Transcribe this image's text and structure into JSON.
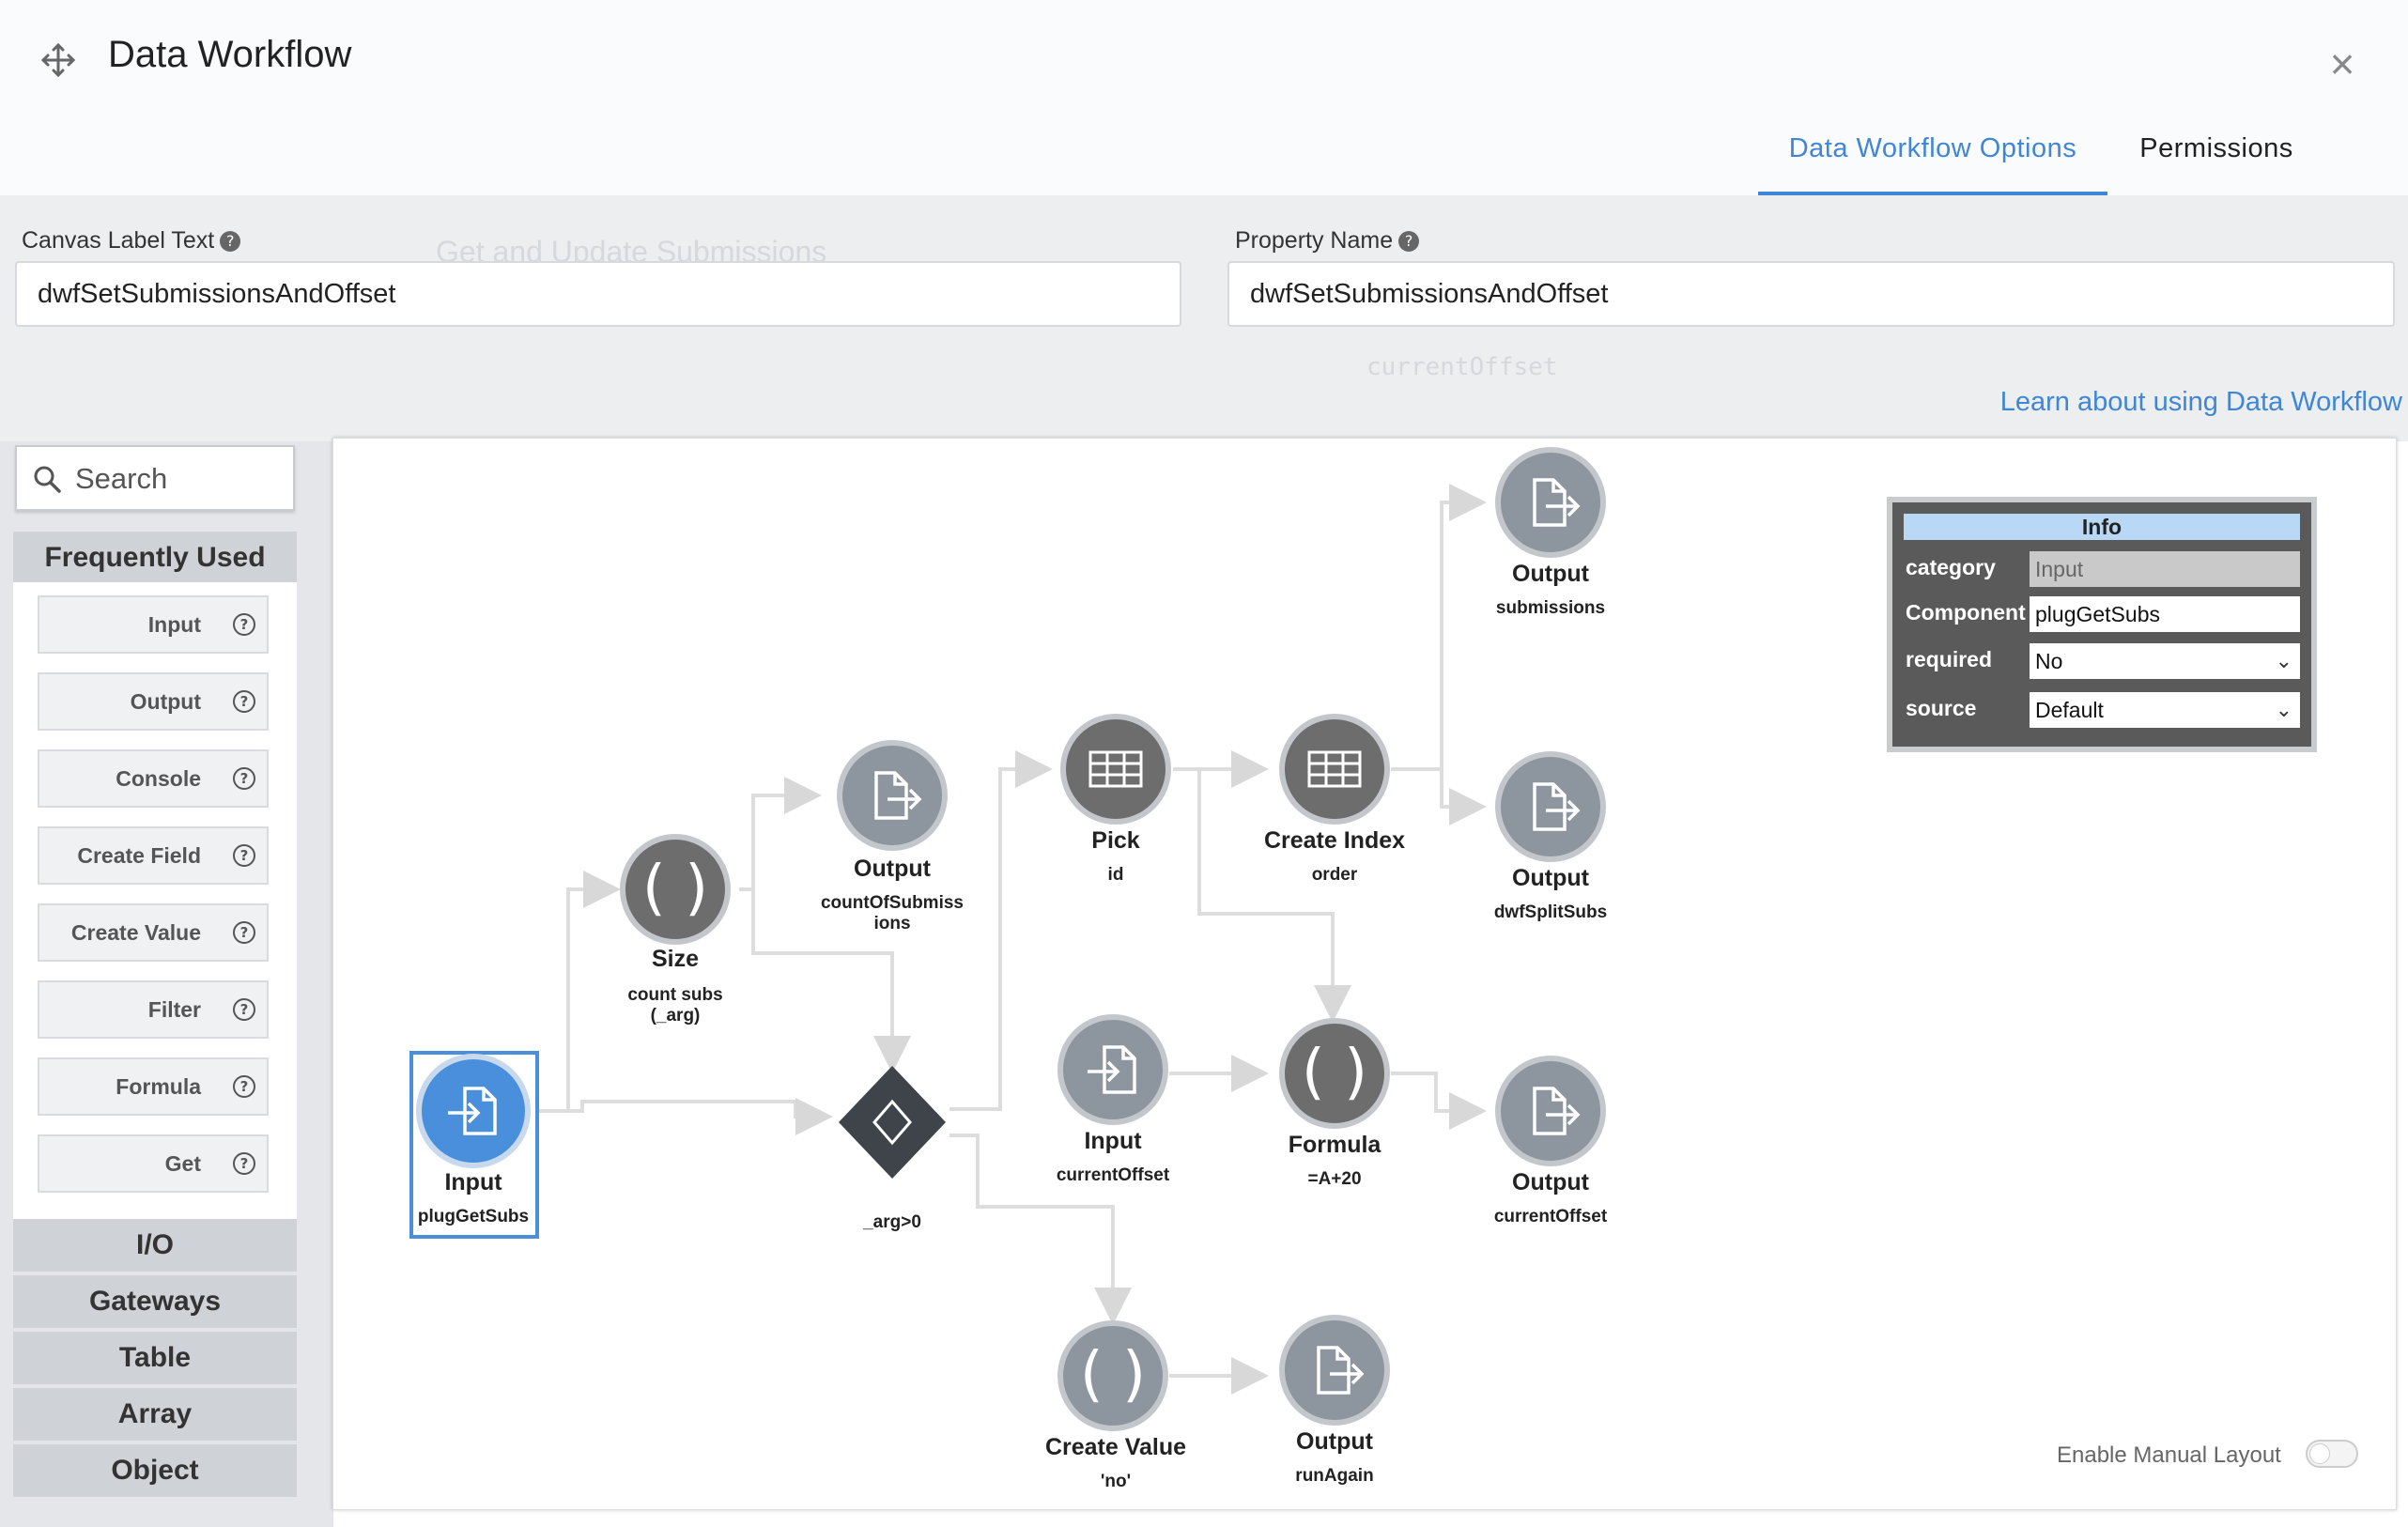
{
  "window": {
    "title": "Data Workflow"
  },
  "tabs": [
    {
      "label": "Data Workflow Options"
    },
    {
      "label": "Permissions"
    }
  ],
  "properties": {
    "canvas_label": {
      "label": "Canvas Label Text",
      "value": "dwfSetSubmissionsAndOffset"
    },
    "property_name": {
      "label": "Property Name",
      "value": "dwfSetSubmissionsAndOffset"
    },
    "learn_link": "Learn about using Data Workflow"
  },
  "background_ghost": {
    "title": "Get and Update Submissions",
    "field": "currentOffset"
  },
  "palette": {
    "search_placeholder": "Search",
    "frequently_used": "Frequently Used",
    "items": [
      "Input",
      "Output",
      "Console",
      "Create Field",
      "Create Value",
      "Filter",
      "Formula",
      "Get"
    ],
    "sections": [
      "I/O",
      "Gateways",
      "Table",
      "Array",
      "Object"
    ]
  },
  "nodes": [
    {
      "id": "n_input",
      "type": "Input",
      "label": "Input",
      "sub": "plugGetSubs"
    },
    {
      "id": "n_size",
      "type": "Size",
      "label": "Size",
      "sub": "count subs (_arg)"
    },
    {
      "id": "n_out_count",
      "type": "Output",
      "label": "Output",
      "sub": "countOfSubmissions"
    },
    {
      "id": "n_gate",
      "type": "Gateway",
      "label": "",
      "sub": "_arg>0"
    },
    {
      "id": "n_pick",
      "type": "Pick",
      "label": "Pick",
      "sub": "id"
    },
    {
      "id": "n_index",
      "type": "Create Index",
      "label": "Create Index",
      "sub": "order"
    },
    {
      "id": "n_out_subs",
      "type": "Output",
      "label": "Output",
      "sub": "submissions"
    },
    {
      "id": "n_out_split",
      "type": "Output",
      "label": "Output",
      "sub": "dwfSplitSubs"
    },
    {
      "id": "n_in_offset",
      "type": "Input",
      "label": "Input",
      "sub": "currentOffset"
    },
    {
      "id": "n_formula",
      "type": "Formula",
      "label": "Formula",
      "sub": "=A+20"
    },
    {
      "id": "n_out_offset",
      "type": "Output",
      "label": "Output",
      "sub": "currentOffset"
    },
    {
      "id": "n_create_value",
      "type": "Create Value",
      "label": "Create Value",
      "sub": "'no'"
    },
    {
      "id": "n_out_run",
      "type": "Output",
      "label": "Output",
      "sub": "runAgain"
    }
  ],
  "info_panel": {
    "title": "Info",
    "rows": [
      {
        "key": "category",
        "value": "Input",
        "readonly": true
      },
      {
        "key": "Component",
        "value": "plugGetSubs"
      },
      {
        "key": "required",
        "value": "No",
        "select": true
      },
      {
        "key": "source",
        "value": "Default",
        "select": true
      }
    ]
  },
  "manual_layout": {
    "label": "Enable Manual Layout",
    "enabled": false
  },
  "colors": {
    "accent": "#3f86d6",
    "node_dark": "#6f6f6f",
    "node_light": "#8d959e",
    "selected_node": "#4a8fdc"
  }
}
